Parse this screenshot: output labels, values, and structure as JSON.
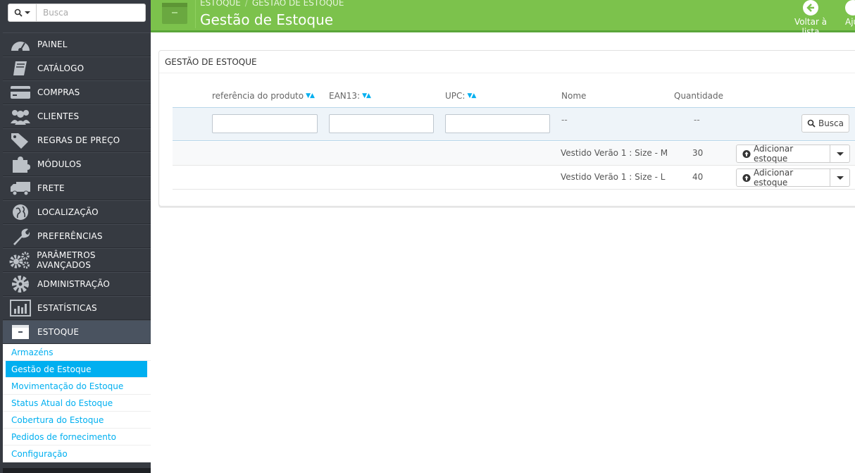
{
  "sidebar": {
    "search_placeholder": "Busca",
    "menu": [
      {
        "label": "PAINEL",
        "icon": "dashboard-icon"
      },
      {
        "label": "CATÁLOGO",
        "icon": "book-icon"
      },
      {
        "label": "COMPRAS",
        "icon": "credit-card-icon"
      },
      {
        "label": "CLIENTES",
        "icon": "users-icon"
      },
      {
        "label": "REGRAS DE PREÇO",
        "icon": "tags-icon"
      },
      {
        "label": "MÓDULOS",
        "icon": "puzzle-icon"
      },
      {
        "label": "FRETE",
        "icon": "truck-icon"
      },
      {
        "label": "LOCALIZAÇÃO",
        "icon": "globe-icon"
      },
      {
        "label": "PREFERÊNCIAS",
        "icon": "wrench-icon"
      },
      {
        "label": "PARÂMETROS AVANÇADOS",
        "icon": "cogs-icon"
      },
      {
        "label": "ADMINISTRAÇÃO",
        "icon": "gear-icon"
      },
      {
        "label": "ESTATÍSTICAS",
        "icon": "bar-chart-icon"
      },
      {
        "label": "ESTOQUE",
        "icon": "archive-icon"
      }
    ],
    "submenu": [
      "Armazéns",
      "Gestão de Estoque",
      "Movimentação do Estoque",
      "Status Atual do Estoque",
      "Cobertura do Estoque",
      "Pedidos de fornecimento",
      "Configuração"
    ]
  },
  "header": {
    "breadcrumb": [
      "ESTOQUE",
      "GESTÃO DE ESTOQUE"
    ],
    "title": "Gestão de Estoque",
    "back_label": "Voltar à lista",
    "help_label": "Aju"
  },
  "panel": {
    "title": "GESTÃO DE ESTOQUE",
    "columns": {
      "reference": "referência do produto",
      "ean13": "EAN13:",
      "upc": "UPC:",
      "name": "Nome",
      "quantity": "Quantidade"
    },
    "filter": {
      "name_placeholder": "--",
      "quantity_placeholder": "--",
      "search_button": "Busca"
    },
    "rows": [
      {
        "name": "Vestido Verão 1 : Size - M",
        "quantity": "30",
        "action": "Adicionar estoque"
      },
      {
        "name": "Vestido Verão 1 : Size - L",
        "quantity": "40",
        "action": "Adicionar estoque"
      }
    ]
  },
  "colors": {
    "header_green": "#7cc24c",
    "sidebar_dark": "#363a41",
    "accent_blue": "#00aff0"
  }
}
